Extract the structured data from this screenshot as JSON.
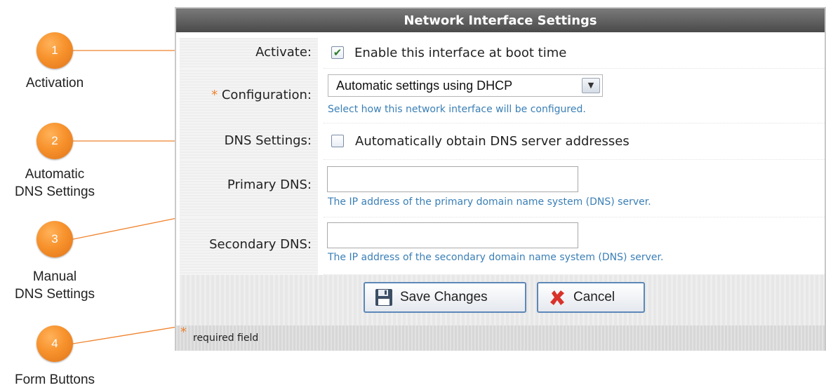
{
  "callouts": [
    {
      "number": "1",
      "caption": "Activation"
    },
    {
      "number": "2",
      "caption": "Automatic\nDNS Settings"
    },
    {
      "number": "3",
      "caption": "Manual\nDNS Settings"
    },
    {
      "number": "4",
      "caption": "Form Buttons"
    }
  ],
  "panel": {
    "title": "Network Interface Settings",
    "activate": {
      "label": "Activate:",
      "checkbox_label": "Enable this interface at boot time",
      "checked": true
    },
    "configuration": {
      "required_mark": "*",
      "label": "Configuration:",
      "selected": "Automatic settings using DHCP",
      "hint": "Select how this network interface will be configured."
    },
    "dns_settings": {
      "label": "DNS Settings:",
      "checkbox_label": "Automatically obtain DNS server addresses",
      "checked": false
    },
    "primary_dns": {
      "label": "Primary DNS:",
      "value": "",
      "hint": "The IP address of the primary domain name system (DNS) server."
    },
    "secondary_dns": {
      "label": "Secondary DNS:",
      "value": "",
      "hint": "The IP address of the secondary domain name system (DNS) server."
    },
    "buttons": {
      "save": "Save Changes",
      "cancel": "Cancel"
    },
    "footer": {
      "required_mark": "*",
      "text": "required field"
    }
  },
  "icons": {
    "save": "floppy-disk-icon",
    "cancel": "red-x-icon",
    "check": "checkmark-icon",
    "dropdown": "chevron-down-icon"
  },
  "colors": {
    "accent": "#f7922c",
    "hint": "#3a7fb6",
    "button_border": "#5d87b8",
    "header": "#5a5a5a"
  }
}
